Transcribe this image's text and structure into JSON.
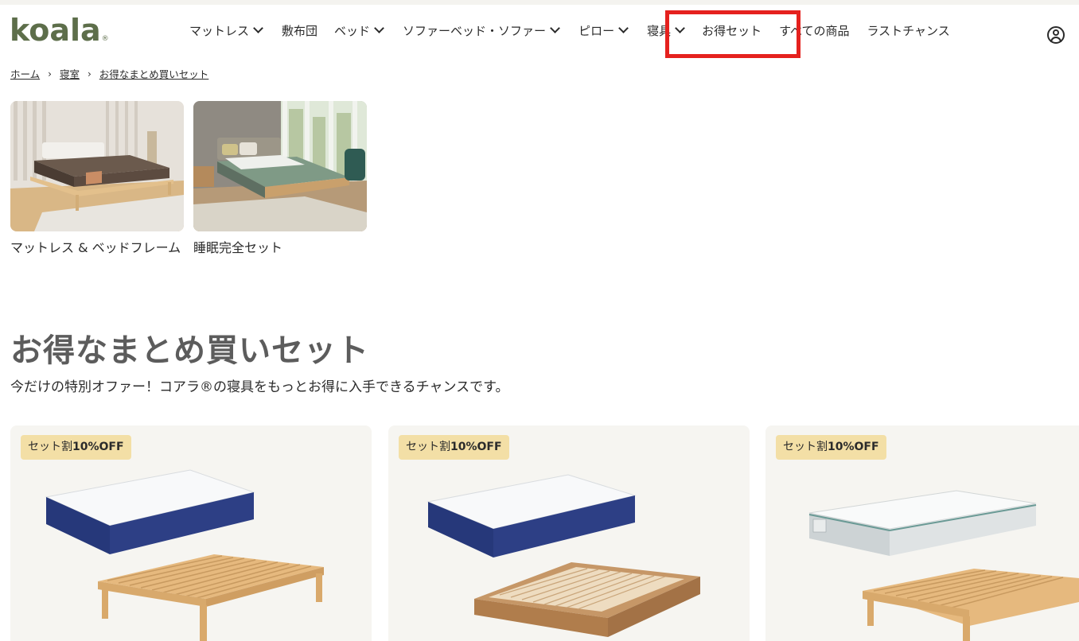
{
  "header": {
    "logo": "koala",
    "nav": [
      {
        "label": "マットレス",
        "dropdown": true
      },
      {
        "label": "敷布団",
        "dropdown": false
      },
      {
        "label": "ベッド",
        "dropdown": true
      },
      {
        "label": "ソファーベッド・ソファー",
        "dropdown": true
      },
      {
        "label": "ピロー",
        "dropdown": true
      },
      {
        "label": "寝具",
        "dropdown": true
      },
      {
        "label": "お得セット",
        "dropdown": false
      },
      {
        "label": "すべての商品",
        "dropdown": false
      },
      {
        "label": "ラストチャンス",
        "dropdown": false
      }
    ],
    "highlight_color": "#e5211e"
  },
  "breadcrumb": [
    "ホーム",
    "寝室",
    "お得なまとめ買いセット"
  ],
  "categories": [
    {
      "label": "マットレス & ベッドフレーム"
    },
    {
      "label": "睡眠完全セット"
    }
  ],
  "page": {
    "title": "お得なまとめ買いセット",
    "subtitle": "今だけの特別オファー！コアラ®の寝具をもっとお得に入手できるチャンスです。"
  },
  "products": [
    {
      "badge_prefix": "セット割",
      "badge_discount": "10%OFF"
    },
    {
      "badge_prefix": "セット割",
      "badge_discount": "10%OFF"
    },
    {
      "badge_prefix": "セット割",
      "badge_discount": "10%OFF"
    }
  ],
  "colors": {
    "brand": "#5d6e4a",
    "badge": "#f3dfa6",
    "card_bg": "#f6f5f1",
    "mattress_navy": "#26387a",
    "wood": "#e2b47a"
  }
}
